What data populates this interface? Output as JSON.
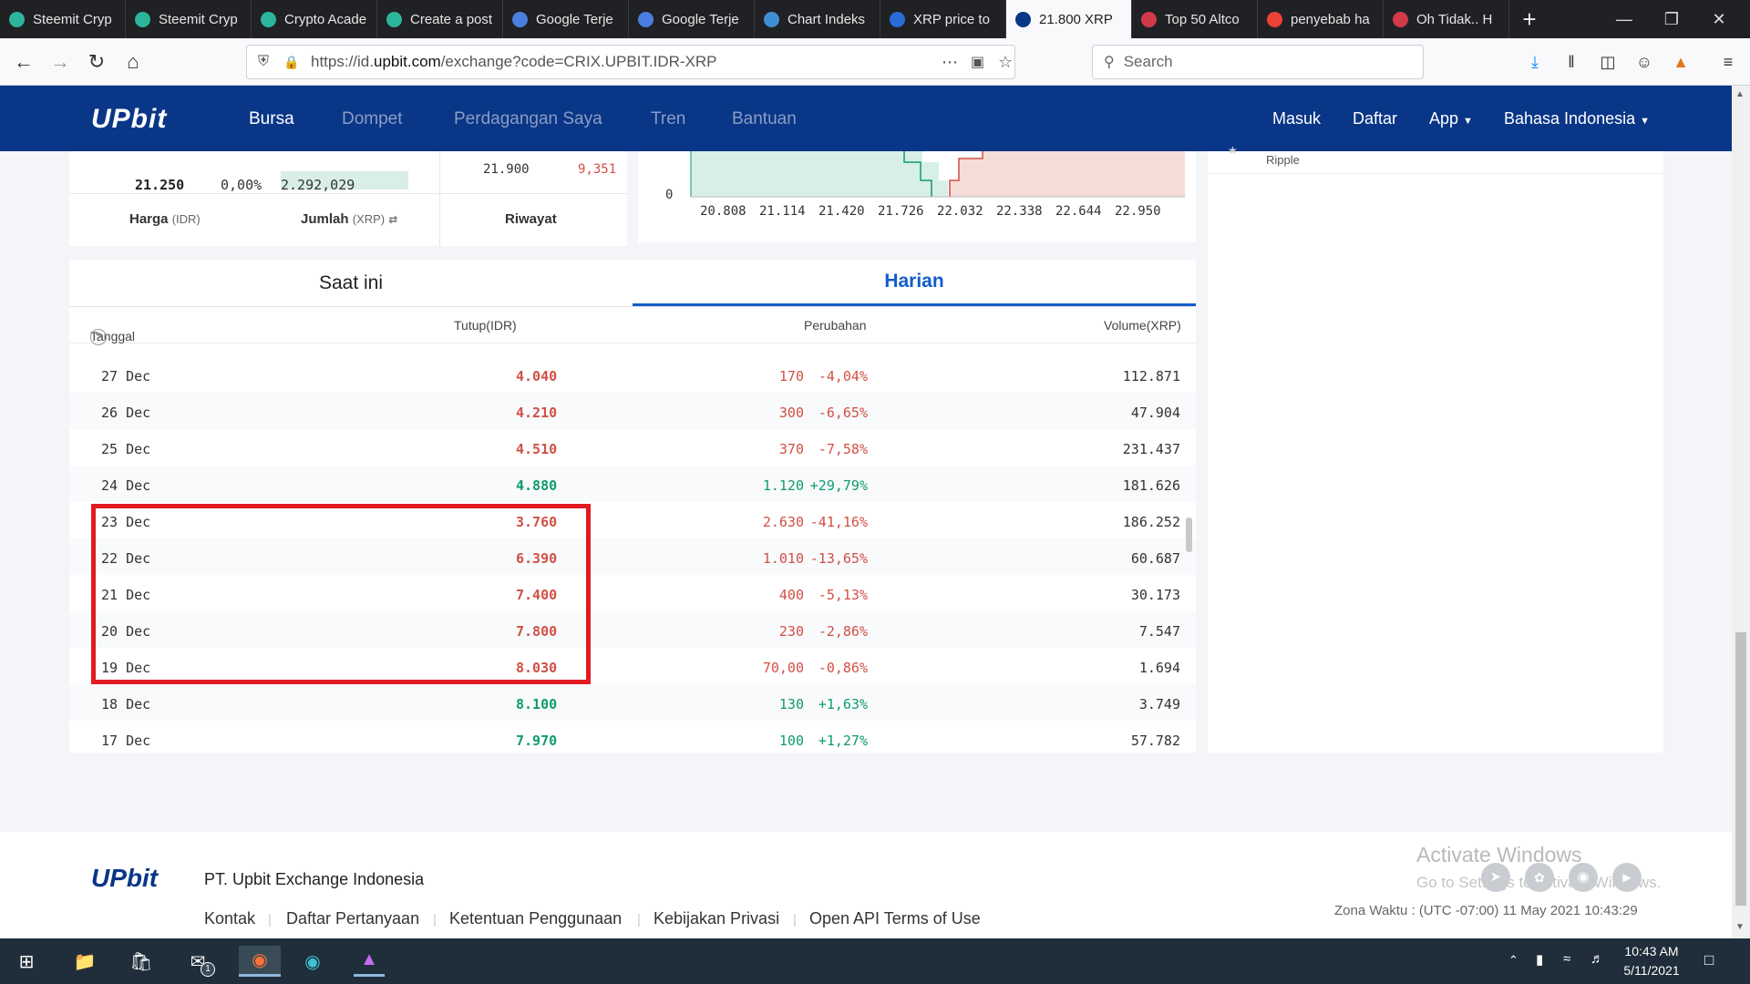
{
  "browser": {
    "tabs": [
      {
        "label": "Steemit Cryp",
        "color": "#2cb59b"
      },
      {
        "label": "Steemit Cryp",
        "color": "#2cb59b"
      },
      {
        "label": "Crypto Acade",
        "color": "#2cb59b"
      },
      {
        "label": "Create a post",
        "color": "#2cb59b"
      },
      {
        "label": "Google Terje",
        "color": "#4a7ee0"
      },
      {
        "label": "Google Terje",
        "color": "#4a7ee0"
      },
      {
        "label": "Chart Indeks",
        "color": "#3f8fd6"
      },
      {
        "label": "XRP price to",
        "color": "#2a6bd8"
      },
      {
        "label": "21.800 XRP",
        "color": "#093687"
      },
      {
        "label": "Top 50 Altco",
        "color": "#d23a4a"
      },
      {
        "label": "penyebab ha",
        "color": "#ea4335"
      },
      {
        "label": "Oh Tidak.. H",
        "color": "#d23a4a"
      }
    ],
    "url_prefix": "https://id.",
    "url_domain": "upbit.com",
    "url_path": "/exchange?code=CRIX.UPBIT.IDR-XRP",
    "search_placeholder": "Search"
  },
  "site": {
    "logo": "UPbit",
    "menu": [
      "Bursa",
      "Dompet",
      "Perdagangan Saya",
      "Tren",
      "Bantuan"
    ],
    "right_menu": {
      "login": "Masuk",
      "register": "Daftar",
      "app": "App",
      "lang": "Bahasa Indonesia"
    }
  },
  "orderbook": {
    "price": "21.250",
    "pct": "0,00%",
    "amount": "2.292,029",
    "ask_price": "21.900",
    "ask_qty": "9,351",
    "headers": {
      "price": "Harga",
      "price_unit": "(IDR)",
      "amount": "Jumlah",
      "amount_unit": "(XRP)",
      "history": "Riwayat"
    }
  },
  "depth_chart": {
    "y_label": "0",
    "x_ticks": [
      "20.808",
      "21.114",
      "21.420",
      "21.726",
      "22.032",
      "22.338",
      "22.644",
      "22.950"
    ]
  },
  "right_panel": {
    "coin_name": "Ripple"
  },
  "history": {
    "tabs": {
      "current": "Saat ini",
      "daily": "Harian"
    },
    "columns": {
      "date": "Tanggal",
      "close": "Tutup(IDR)",
      "change": "Perubahan",
      "volume": "Volume(XRP)"
    },
    "rows": [
      {
        "date": "27 Dec",
        "close": "4.040",
        "diff": "170",
        "pct": "-4,04%",
        "volume": "112.871",
        "dir": "down"
      },
      {
        "date": "26 Dec",
        "close": "4.210",
        "diff": "300",
        "pct": "-6,65%",
        "volume": "47.904",
        "dir": "down"
      },
      {
        "date": "25 Dec",
        "close": "4.510",
        "diff": "370",
        "pct": "-7,58%",
        "volume": "231.437",
        "dir": "down"
      },
      {
        "date": "24 Dec",
        "close": "4.880",
        "diff": "1.120",
        "pct": "+29,79%",
        "volume": "181.626",
        "dir": "up"
      },
      {
        "date": "23 Dec",
        "close": "3.760",
        "diff": "2.630",
        "pct": "-41,16%",
        "volume": "186.252",
        "dir": "down"
      },
      {
        "date": "22 Dec",
        "close": "6.390",
        "diff": "1.010",
        "pct": "-13,65%",
        "volume": "60.687",
        "dir": "down"
      },
      {
        "date": "21 Dec",
        "close": "7.400",
        "diff": "400",
        "pct": "-5,13%",
        "volume": "30.173",
        "dir": "down"
      },
      {
        "date": "20 Dec",
        "close": "7.800",
        "diff": "230",
        "pct": "-2,86%",
        "volume": "7.547",
        "dir": "down"
      },
      {
        "date": "19 Dec",
        "close": "8.030",
        "diff": "70,00",
        "pct": "-0,86%",
        "volume": "1.694",
        "dir": "down"
      },
      {
        "date": "18 Dec",
        "close": "8.100",
        "diff": "130",
        "pct": "+1,63%",
        "volume": "3.749",
        "dir": "up"
      },
      {
        "date": "17 Dec",
        "close": "7.970",
        "diff": "100",
        "pct": "+1,27%",
        "volume": "57.782",
        "dir": "up"
      }
    ]
  },
  "footer": {
    "logo": "UPbit",
    "company": "PT. Upbit Exchange Indonesia",
    "links": [
      "Kontak",
      "Daftar Pertanyaan",
      "Ketentuan Penggunaan",
      "Kebijakan Privasi",
      "Open API Terms of Use"
    ],
    "timezone": "Zona Waktu : (UTC -07:00) 11 May 2021 10:43:29",
    "activate1": "Activate Windows",
    "activate2": "Go to Settings to activate Windows."
  },
  "taskbar": {
    "time": "10:43 AM",
    "date": "5/11/2021",
    "mail_badge": "1"
  }
}
